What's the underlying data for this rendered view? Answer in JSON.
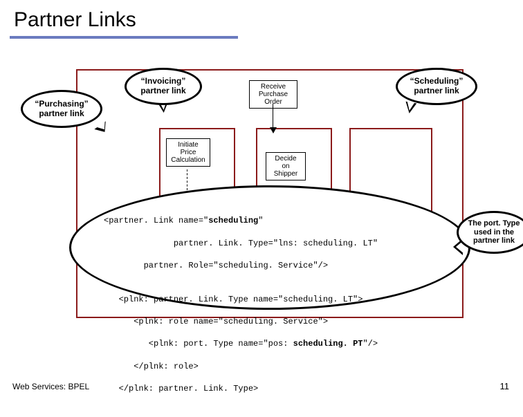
{
  "title": "Partner Links",
  "callouts": {
    "purchasing": {
      "line1": "“Purchasing”",
      "line2": "partner link"
    },
    "invoicing": {
      "line1": "“Invoicing”",
      "line2": "partner link"
    },
    "scheduling": {
      "line1": "“Scheduling”",
      "line2": "partner link"
    },
    "porttype": {
      "line1": "The port. Type",
      "line2": "used in the",
      "line3": "partner link"
    }
  },
  "boxes": {
    "rpo": "Receive\nPurchase\nOrder",
    "ipc": "Initiate\nPrice\nCalculation",
    "dos": "Decide\non\nShipper"
  },
  "code": {
    "l1a": "<partner. Link name=\"",
    "l1b": "scheduling",
    "l1c": "\"",
    "l2": "              partner. Link. Type=\"lns: scheduling. LT\"",
    "l3": "        partner. Role=\"scheduling. Service\"/>",
    "l4": "",
    "l5": "   <plnk: partner. Link. Type name=\"scheduling. LT\">",
    "l6": "      <plnk: role name=\"scheduling. Service\">",
    "l7a": "         <plnk: port. Type name=\"pos: ",
    "l7b": "scheduling. PT",
    "l7c": "\"/>",
    "l8": "      </plnk: role>",
    "l9": "   </plnk: partner. Link. Type>"
  },
  "footer": {
    "left": "Web Services: BPEL",
    "right": "11"
  }
}
